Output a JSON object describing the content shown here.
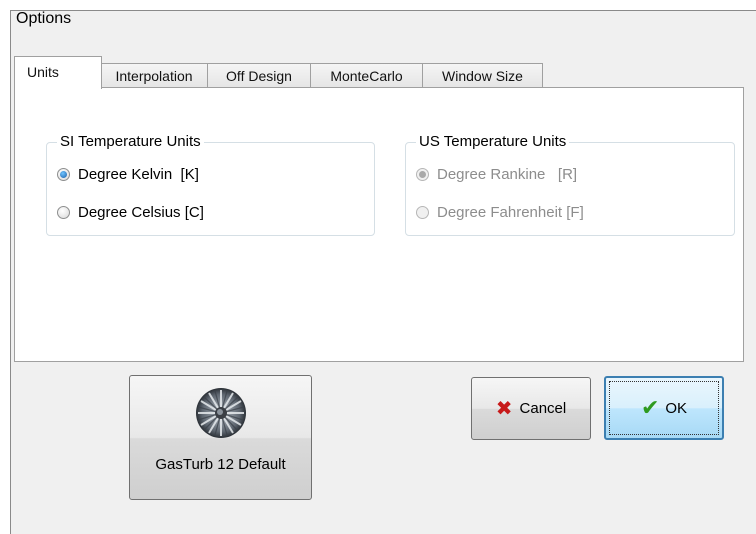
{
  "window": {
    "title": "Options"
  },
  "tabs": [
    {
      "label": "Units",
      "active": true
    },
    {
      "label": "Interpolation",
      "active": false
    },
    {
      "label": "Off Design",
      "active": false
    },
    {
      "label": "MonteCarlo",
      "active": false
    },
    {
      "label": "Window Size",
      "active": false
    }
  ],
  "si_group": {
    "title": "SI Temperature Units",
    "options": [
      {
        "label": "Degree Kelvin  [K]",
        "checked": true
      },
      {
        "label": "Degree Celsius [C]",
        "checked": false
      }
    ]
  },
  "us_group": {
    "title": "US Temperature Units",
    "enabled": false,
    "options": [
      {
        "label": "Degree Rankine   [R]",
        "checked": true
      },
      {
        "label": "Degree Fahrenheit [F]",
        "checked": false
      }
    ]
  },
  "buttons": {
    "defaults_label": "GasTurb 12 Default",
    "cancel_label": "Cancel",
    "ok_label": "OK"
  },
  "icons": {
    "defaults": "turbine-fan-icon",
    "cancel": "red-x-icon",
    "ok": "green-check-icon"
  }
}
